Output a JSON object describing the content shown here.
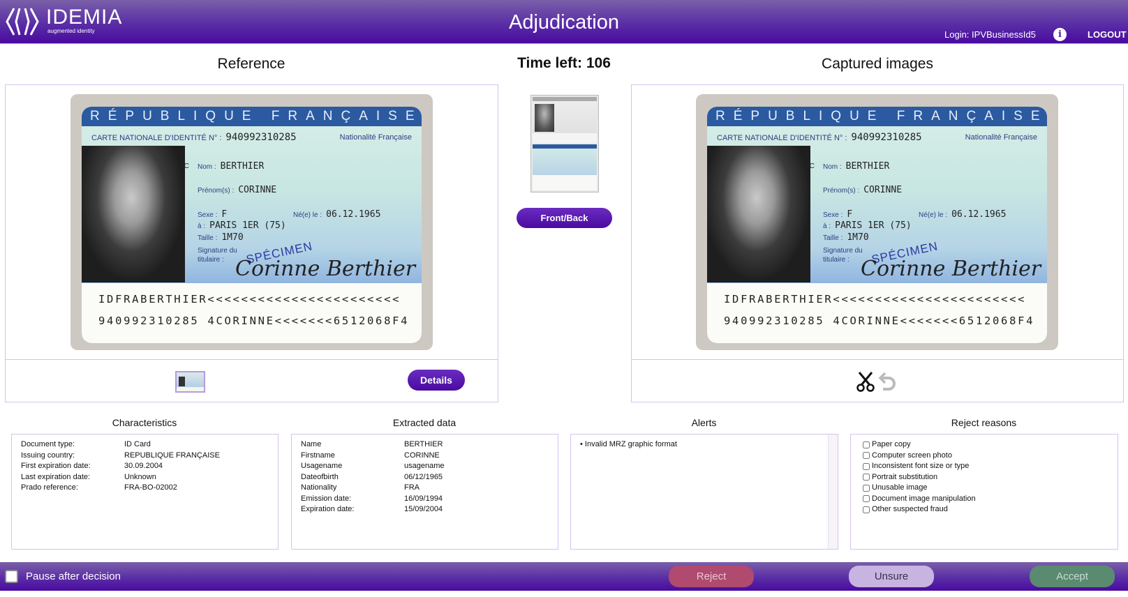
{
  "header": {
    "logo_name": "IDEMIA",
    "logo_tagline": "augmented identity",
    "title": "Adjudication",
    "login": "Login: IPVBusinessId5",
    "info_icon": "info-circle-icon",
    "logout_label": "LOGOUT"
  },
  "reference": {
    "title": "Reference",
    "details_label": "Details"
  },
  "center": {
    "timer": "Time left: 106",
    "front_back_label": "Front/Back"
  },
  "captured": {
    "title": "Captured images",
    "crop_icon": "scissors-icon",
    "undo_icon": "undo-arrow-icon"
  },
  "id_card": {
    "country_band": "RÉPUBLIQUE FRANÇAISE",
    "card_no_label": "CARTE NATIONALE D'IDENTITÉ N° :",
    "card_no": "940992310285",
    "nationality": "Nationalité Française",
    "code": "BC",
    "nom_label": "Nom :",
    "nom": "BERTHIER",
    "prenom_label": "Prénom(s) :",
    "prenom": "CORINNE",
    "sexe_label": "Sexe :",
    "sexe": "F",
    "ne_label": "Né(e) le :",
    "ne": "06.12.1965",
    "a_label": "à :",
    "a": "PARIS 1ER (75)",
    "taille_label": "Taille :",
    "taille": "1M70",
    "signature_label": "Signature du titulaire :",
    "signature": "Corinne Berthier",
    "specimen": "SPÉCIMEN",
    "mrz_line1": "IDFRABERTHIER<<<<<<<<<<<<<<<<<<<<<<<",
    "mrz_line2": "940992310285 4CORINNE<<<<<<<6512068F4"
  },
  "characteristics": {
    "title": "Characteristics",
    "rows": [
      {
        "label": "Document type:",
        "value": "ID Card"
      },
      {
        "label": "Issuing country:",
        "value": "REPUBLIQUE FRANÇAISE"
      },
      {
        "label": "First expiration date:",
        "value": "30.09.2004"
      },
      {
        "label": "Last expiration date:",
        "value": "Unknown"
      },
      {
        "label": "Prado reference:",
        "value": "FRA-BO-02002"
      }
    ]
  },
  "extracted": {
    "title": "Extracted data",
    "rows": [
      {
        "label": "Name",
        "value": "BERTHIER"
      },
      {
        "label": "Firstname",
        "value": "CORINNE"
      },
      {
        "label": "Usagename",
        "value": "usagename"
      },
      {
        "label": "Dateofbirth",
        "value": "06/12/1965"
      },
      {
        "label": "Nationality",
        "value": "FRA"
      },
      {
        "label": "Emission date:",
        "value": "16/09/1994"
      },
      {
        "label": "Expiration date:",
        "value": "15/09/2004"
      }
    ]
  },
  "alerts": {
    "title": "Alerts",
    "items": [
      "• Invalid MRZ graphic format"
    ]
  },
  "reject_reasons": {
    "title": "Reject reasons",
    "items": [
      {
        "label": "Paper copy",
        "checked": false
      },
      {
        "label": "Computer screen photo",
        "checked": false
      },
      {
        "label": "Inconsistent font size or type",
        "checked": false
      },
      {
        "label": "Portrait substitution",
        "checked": false
      },
      {
        "label": "Unusable image",
        "checked": false
      },
      {
        "label": "Document image manipulation",
        "checked": false
      },
      {
        "label": "Other suspected fraud",
        "checked": false
      }
    ]
  },
  "footer": {
    "pause_label": "Pause after decision",
    "pause_checked": false,
    "reject_label": "Reject",
    "unsure_label": "Unsure",
    "accept_label": "Accept",
    "reject_color": "#b04a6e",
    "unsure_color": "#c8b4e0",
    "accept_color": "#5a8a70"
  }
}
